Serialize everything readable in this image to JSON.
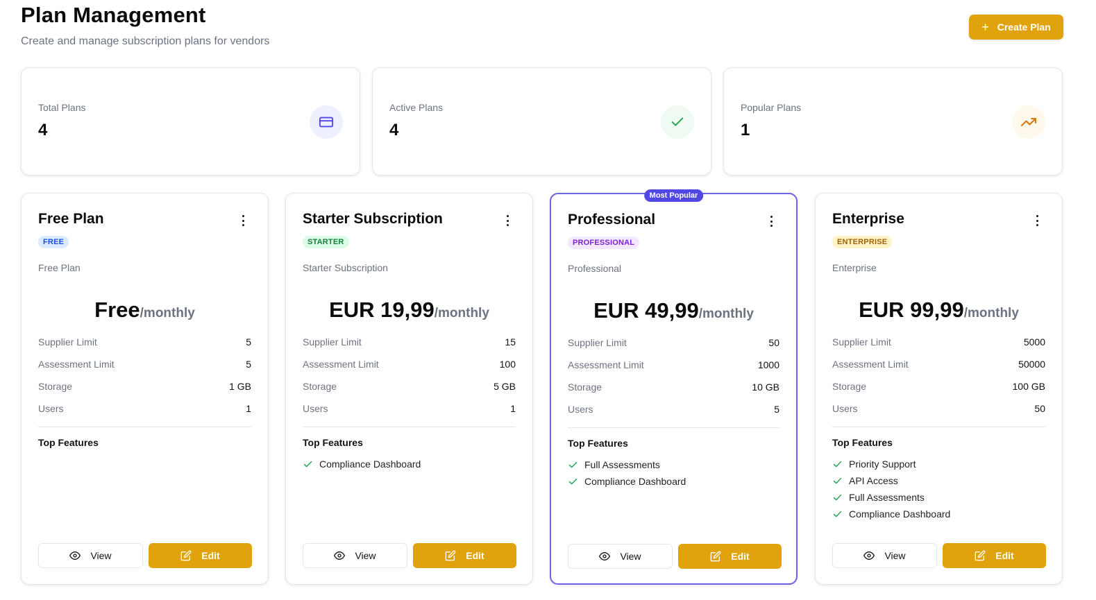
{
  "header": {
    "title": "Plan Management",
    "subtitle": "Create and manage subscription plans for vendors",
    "create_button": {
      "icon": "plus-icon",
      "label": "Create Plan"
    }
  },
  "stats": [
    {
      "label": "Total Plans",
      "value": "4",
      "icon": "credit-card-icon",
      "icon_color": "#4f46e5",
      "icon_bg": "#eef0ff"
    },
    {
      "label": "Active Plans",
      "value": "4",
      "icon": "check-icon",
      "icon_color": "#16a34a",
      "icon_bg": "#effaf2"
    },
    {
      "label": "Popular Plans",
      "value": "1",
      "icon": "trending-up-icon",
      "icon_color": "#d97706",
      "icon_bg": "#fff8ec"
    }
  ],
  "limit_labels": {
    "supplier": "Supplier Limit",
    "assessment": "Assessment Limit",
    "storage": "Storage",
    "users": "Users"
  },
  "features_title": "Top Features",
  "buttons": {
    "view": "View",
    "edit": "Edit"
  },
  "popular_badge": "Most Popular",
  "period": "/monthly",
  "plans": [
    {
      "name": "Free Plan",
      "tier": "FREE",
      "tier_color": "#1d4ed8",
      "tier_bg": "#dbeafe",
      "description": "Free Plan",
      "price": "Free",
      "supplier_limit": "5",
      "assessment_limit": "5",
      "storage": "1 GB",
      "users": "1",
      "features": [],
      "popular": false
    },
    {
      "name": "Starter Subscription",
      "tier": "STARTER",
      "tier_color": "#15803d",
      "tier_bg": "#dcfce7",
      "description": "Starter Subscription",
      "price": "EUR 19,99",
      "supplier_limit": "15",
      "assessment_limit": "100",
      "storage": "5 GB",
      "users": "1",
      "features": [
        "Compliance Dashboard"
      ],
      "popular": false
    },
    {
      "name": "Professional",
      "tier": "PROFESSIONAL",
      "tier_color": "#7e22ce",
      "tier_bg": "#f3e8ff",
      "description": "Professional",
      "price": "EUR 49,99",
      "supplier_limit": "50",
      "assessment_limit": "1000",
      "storage": "10 GB",
      "users": "5",
      "features": [
        "Full Assessments",
        "Compliance Dashboard"
      ],
      "popular": true
    },
    {
      "name": "Enterprise",
      "tier": "ENTERPRISE",
      "tier_color": "#a16207",
      "tier_bg": "#fef3c7",
      "description": "Enterprise",
      "price": "EUR 99,99",
      "supplier_limit": "5000",
      "assessment_limit": "50000",
      "storage": "100 GB",
      "users": "50",
      "features": [
        "Priority Support",
        "API Access",
        "Full Assessments",
        "Compliance Dashboard"
      ],
      "popular": false
    }
  ]
}
